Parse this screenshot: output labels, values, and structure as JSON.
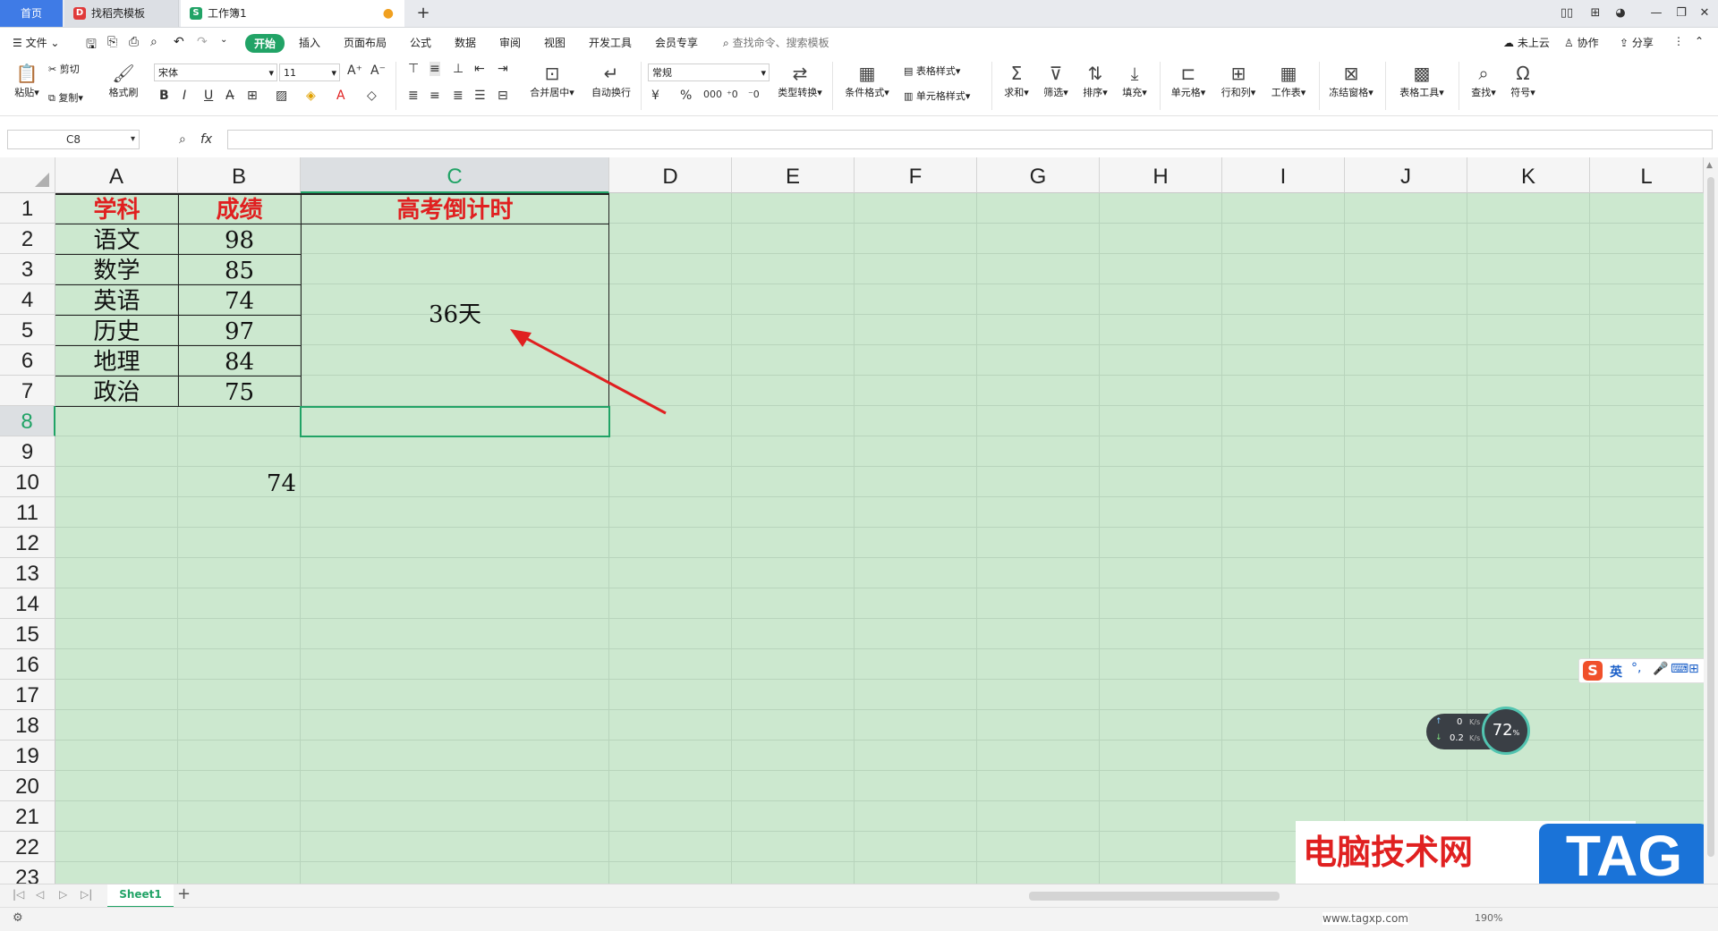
{
  "tabs": {
    "home": "首页",
    "template": "找稻壳模板",
    "workbook": "工作簿1"
  },
  "menu": {
    "file": "文件",
    "items": [
      "开始",
      "插入",
      "页面布局",
      "公式",
      "数据",
      "审阅",
      "视图",
      "开发工具",
      "会员专享"
    ],
    "search": "查找命令、搜索模板",
    "right": [
      "未上云",
      "协作",
      "分享"
    ]
  },
  "ribbon": {
    "paste": "粘贴",
    "cut": "剪切",
    "copy": "复制",
    "format_painter": "格式刷",
    "font_name": "宋体",
    "font_size": "11",
    "merge_center": "合并居中",
    "wrap": "自动换行",
    "number_format": "常规",
    "type_convert": "类型转换",
    "cond_format": "条件格式",
    "table_style": "表格样式",
    "cell_style": "单元格样式",
    "sum": "求和",
    "filter": "筛选",
    "sort": "排序",
    "fill": "填充",
    "cell": "单元格",
    "row_col": "行和列",
    "worksheet": "工作表",
    "freeze": "冻结窗格",
    "table_tools": "表格工具",
    "find": "查找",
    "symbol": "符号"
  },
  "formula_bar": {
    "name_box": "C8",
    "fx": "fx",
    "content": ""
  },
  "columns": [
    "A",
    "B",
    "C",
    "D",
    "E",
    "F",
    "G",
    "H",
    "I",
    "J",
    "K",
    "L"
  ],
  "rows": [
    "1",
    "2",
    "3",
    "4",
    "5",
    "6",
    "7",
    "8",
    "9",
    "10",
    "11",
    "12",
    "13",
    "14",
    "15",
    "16",
    "17",
    "18",
    "19",
    "20",
    "21",
    "22",
    "23"
  ],
  "table": {
    "headers": [
      "学科",
      "成绩",
      "高考倒计时"
    ],
    "rows": [
      [
        "语文",
        "98"
      ],
      [
        "数学",
        "85"
      ],
      [
        "英语",
        "74"
      ],
      [
        "历史",
        "97"
      ],
      [
        "地理",
        "84"
      ],
      [
        "政治",
        "75"
      ]
    ],
    "countdown": "36天",
    "b10": "74"
  },
  "sheet_tab": "Sheet1",
  "ime": {
    "lang": "英"
  },
  "net_widget": {
    "up": "0",
    "down": "0.2",
    "unit": "K/s",
    "percent": "72"
  },
  "watermark": {
    "site_cn": "电脑技术网",
    "site_url": "www.tagxp.com",
    "logo": "TAG"
  },
  "status": {
    "zoom": "190%"
  },
  "colors": {
    "grid_bg": "#cce8cf",
    "accent": "#21a366",
    "header_red": "#e02020",
    "arrow": "#e02020"
  }
}
